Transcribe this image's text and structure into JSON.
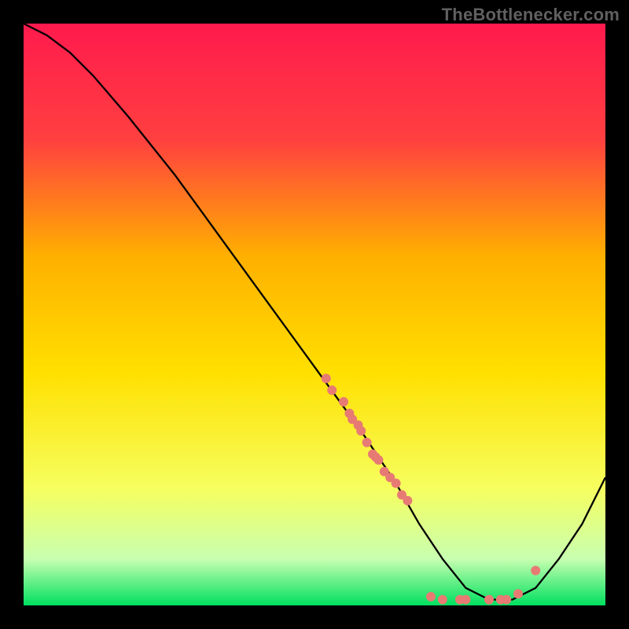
{
  "attribution": "TheBottlenecker.com",
  "chart_data": {
    "type": "line",
    "title": "",
    "xlabel": "",
    "ylabel": "",
    "xlim": [
      0,
      100
    ],
    "ylim": [
      0,
      100
    ],
    "grid": false,
    "legend": false,
    "background": "red-yellow-green-vertical-gradient",
    "gradient_stops": [
      {
        "pos": 0.0,
        "color": "#ff1a4d"
      },
      {
        "pos": 0.2,
        "color": "#ff4040"
      },
      {
        "pos": 0.4,
        "color": "#ffb000"
      },
      {
        "pos": 0.6,
        "color": "#ffe000"
      },
      {
        "pos": 0.8,
        "color": "#f6ff60"
      },
      {
        "pos": 0.92,
        "color": "#c8ffb0"
      },
      {
        "pos": 1.0,
        "color": "#00e060"
      }
    ],
    "series": [
      {
        "name": "bottleneck-curve",
        "stroke": "#000000",
        "stroke_width": 2.3,
        "x": [
          0,
          4,
          8,
          12,
          18,
          26,
          34,
          42,
          50,
          58,
          64,
          68,
          72,
          76,
          80,
          84,
          88,
          92,
          96,
          100
        ],
        "y": [
          100,
          98,
          95,
          91,
          84,
          74,
          63,
          52,
          41,
          30,
          21,
          14,
          8,
          3,
          1,
          1,
          3,
          8,
          14,
          22
        ]
      }
    ],
    "points": {
      "name": "sample-dots",
      "fill": "#e77b74",
      "radius": 6,
      "data": [
        {
          "x": 52,
          "y": 39
        },
        {
          "x": 53,
          "y": 37
        },
        {
          "x": 55,
          "y": 35
        },
        {
          "x": 56,
          "y": 33
        },
        {
          "x": 56.5,
          "y": 32
        },
        {
          "x": 57.5,
          "y": 31
        },
        {
          "x": 58,
          "y": 30
        },
        {
          "x": 59,
          "y": 28
        },
        {
          "x": 60,
          "y": 26
        },
        {
          "x": 60.5,
          "y": 25.5
        },
        {
          "x": 61,
          "y": 25
        },
        {
          "x": 62,
          "y": 23
        },
        {
          "x": 63,
          "y": 22
        },
        {
          "x": 64,
          "y": 21
        },
        {
          "x": 65,
          "y": 19
        },
        {
          "x": 66,
          "y": 18
        },
        {
          "x": 70,
          "y": 1.5
        },
        {
          "x": 72,
          "y": 1
        },
        {
          "x": 75,
          "y": 1
        },
        {
          "x": 76,
          "y": 1
        },
        {
          "x": 80,
          "y": 1
        },
        {
          "x": 82,
          "y": 1
        },
        {
          "x": 83,
          "y": 1
        },
        {
          "x": 85,
          "y": 2
        },
        {
          "x": 88,
          "y": 6
        }
      ]
    }
  }
}
